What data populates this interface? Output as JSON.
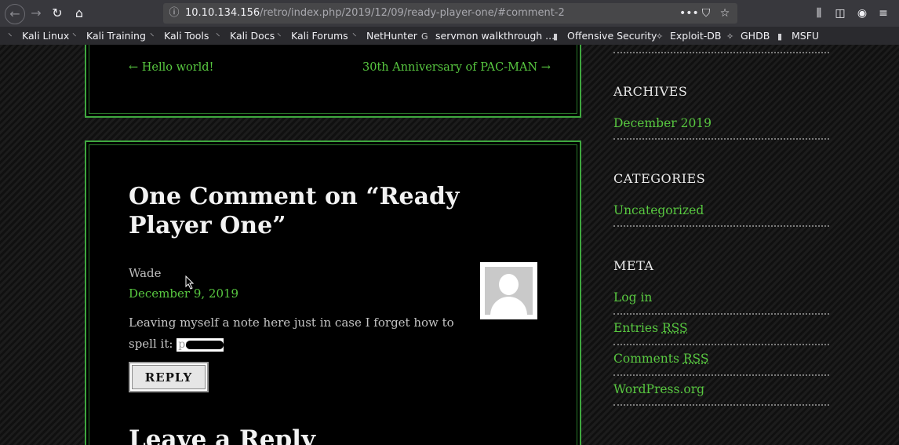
{
  "browser": {
    "url_host": "10.10.134.156",
    "url_path": "/retro/index.php/2019/12/09/ready-player-one/#comment-2",
    "bookmarks": [
      {
        "label": "Kali Linux",
        "icon": "kali-icon"
      },
      {
        "label": "Kali Training",
        "icon": "kali-icon"
      },
      {
        "label": "Kali Tools",
        "icon": "kali-icon"
      },
      {
        "label": "Kali Docs",
        "icon": "kali-icon"
      },
      {
        "label": "Kali Forums",
        "icon": "kali-icon"
      },
      {
        "label": "NetHunter",
        "icon": "kali-icon"
      },
      {
        "label": "servmon walkthrough ...",
        "icon": "google-icon"
      },
      {
        "label": "Offensive Security",
        "icon": "offsec-icon"
      },
      {
        "label": "Exploit-DB",
        "icon": "exploitdb-icon"
      },
      {
        "label": "GHDB",
        "icon": "exploitdb-icon"
      },
      {
        "label": "MSFU",
        "icon": "offsec-icon"
      }
    ]
  },
  "post_nav": {
    "prev": "← Hello world!",
    "next": "30th Anniversary of PAC-MAN →"
  },
  "comments": {
    "title": "One Comment on “Ready Player One”",
    "author": "Wade",
    "date": "December 9, 2019",
    "body": "Leaving myself a note here just in case I forget how to spell it:",
    "redacted_visible": "pa",
    "reply_label": "REPLY"
  },
  "leave_reply": "Leave a Reply",
  "sidebar": {
    "archives_title": "ARCHIVES",
    "archives_link": "December 2019",
    "categories_title": "CATEGORIES",
    "categories_link": "Uncategorized",
    "meta_title": "META",
    "meta_login": "Log in",
    "meta_entries_prefix": "Entries ",
    "meta_comments_prefix": "Comments ",
    "meta_rss": "RSS",
    "meta_wordpress": "WordPress.org"
  },
  "colors": {
    "link_green": "#58c840",
    "panel_border": "#3fa83f"
  }
}
